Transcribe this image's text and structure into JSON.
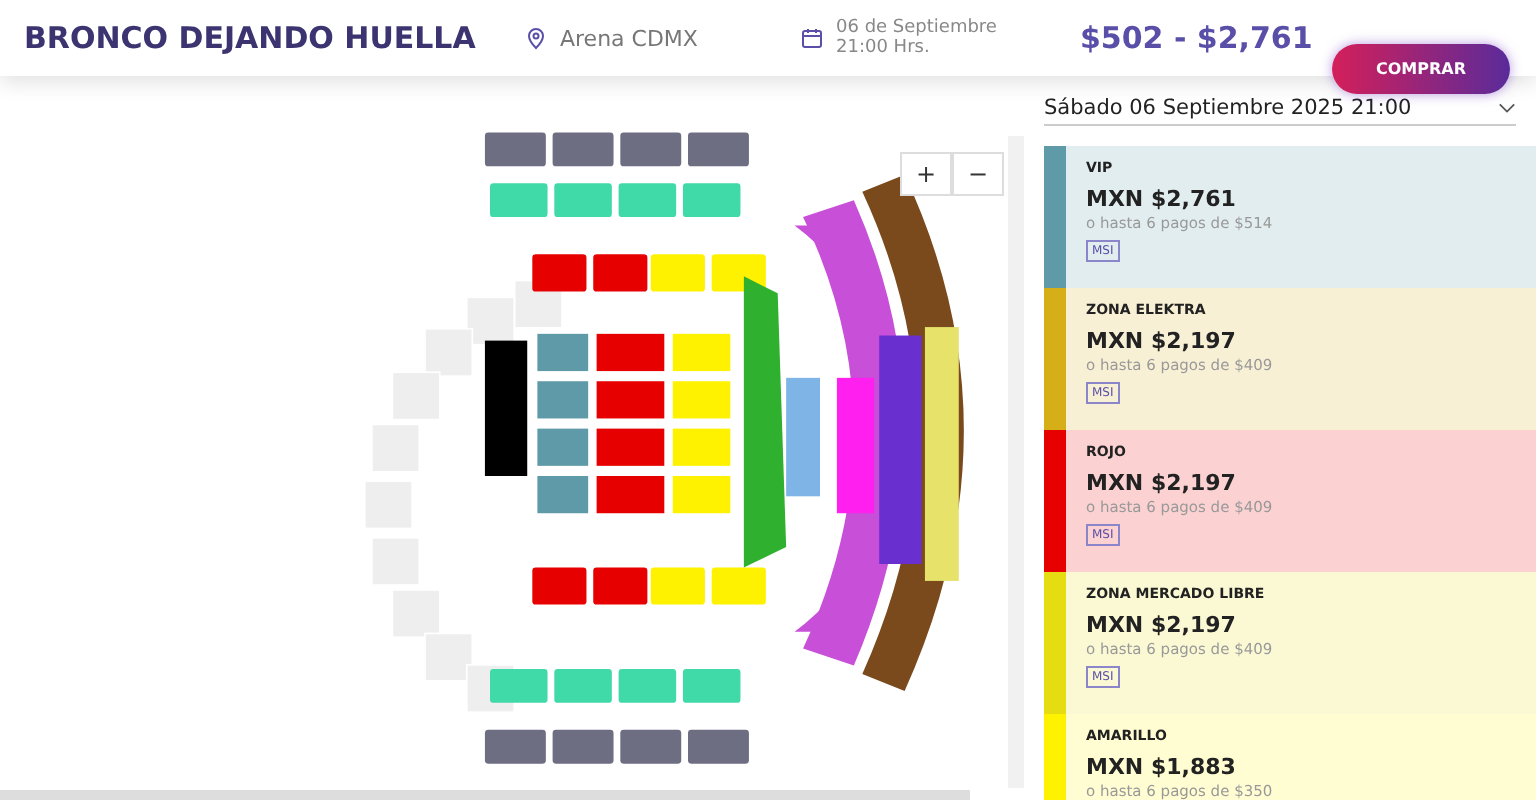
{
  "header": {
    "title": "BRONCO DEJANDO HUELLA",
    "venue": "Arena CDMX",
    "date": "06 de Septiembre 21:00 Hrs.",
    "price_range": "$502 - $2,761",
    "buy_button": "COMPRAR"
  },
  "date_select": {
    "value": "Sábado 06 Septiembre 2025 21:00"
  },
  "map": {
    "zoom_in": "+",
    "zoom_out": "−"
  },
  "zones": [
    {
      "name": "VIP",
      "price": "MXN $2,761",
      "installments": "o hasta 6 pagos de $514",
      "badge": "MSI",
      "color": "#5e9aa8"
    },
    {
      "name": "ZONA ELEKTRA",
      "price": "MXN $2,197",
      "installments": "o hasta 6 pagos de $409",
      "badge": "MSI",
      "color": "#d6ae17"
    },
    {
      "name": "ROJO",
      "price": "MXN $2,197",
      "installments": "o hasta 6 pagos de $409",
      "badge": "MSI",
      "color": "#e60000"
    },
    {
      "name": "ZONA MERCADO LIBRE",
      "price": "MXN $2,197",
      "installments": "o hasta 6 pagos de $409",
      "badge": "MSI",
      "color": "#e6dc12"
    },
    {
      "name": "AMARILLO",
      "price": "MXN $1,883",
      "installments": "o hasta 6 pagos de $350",
      "color": "#fff200"
    }
  ]
}
